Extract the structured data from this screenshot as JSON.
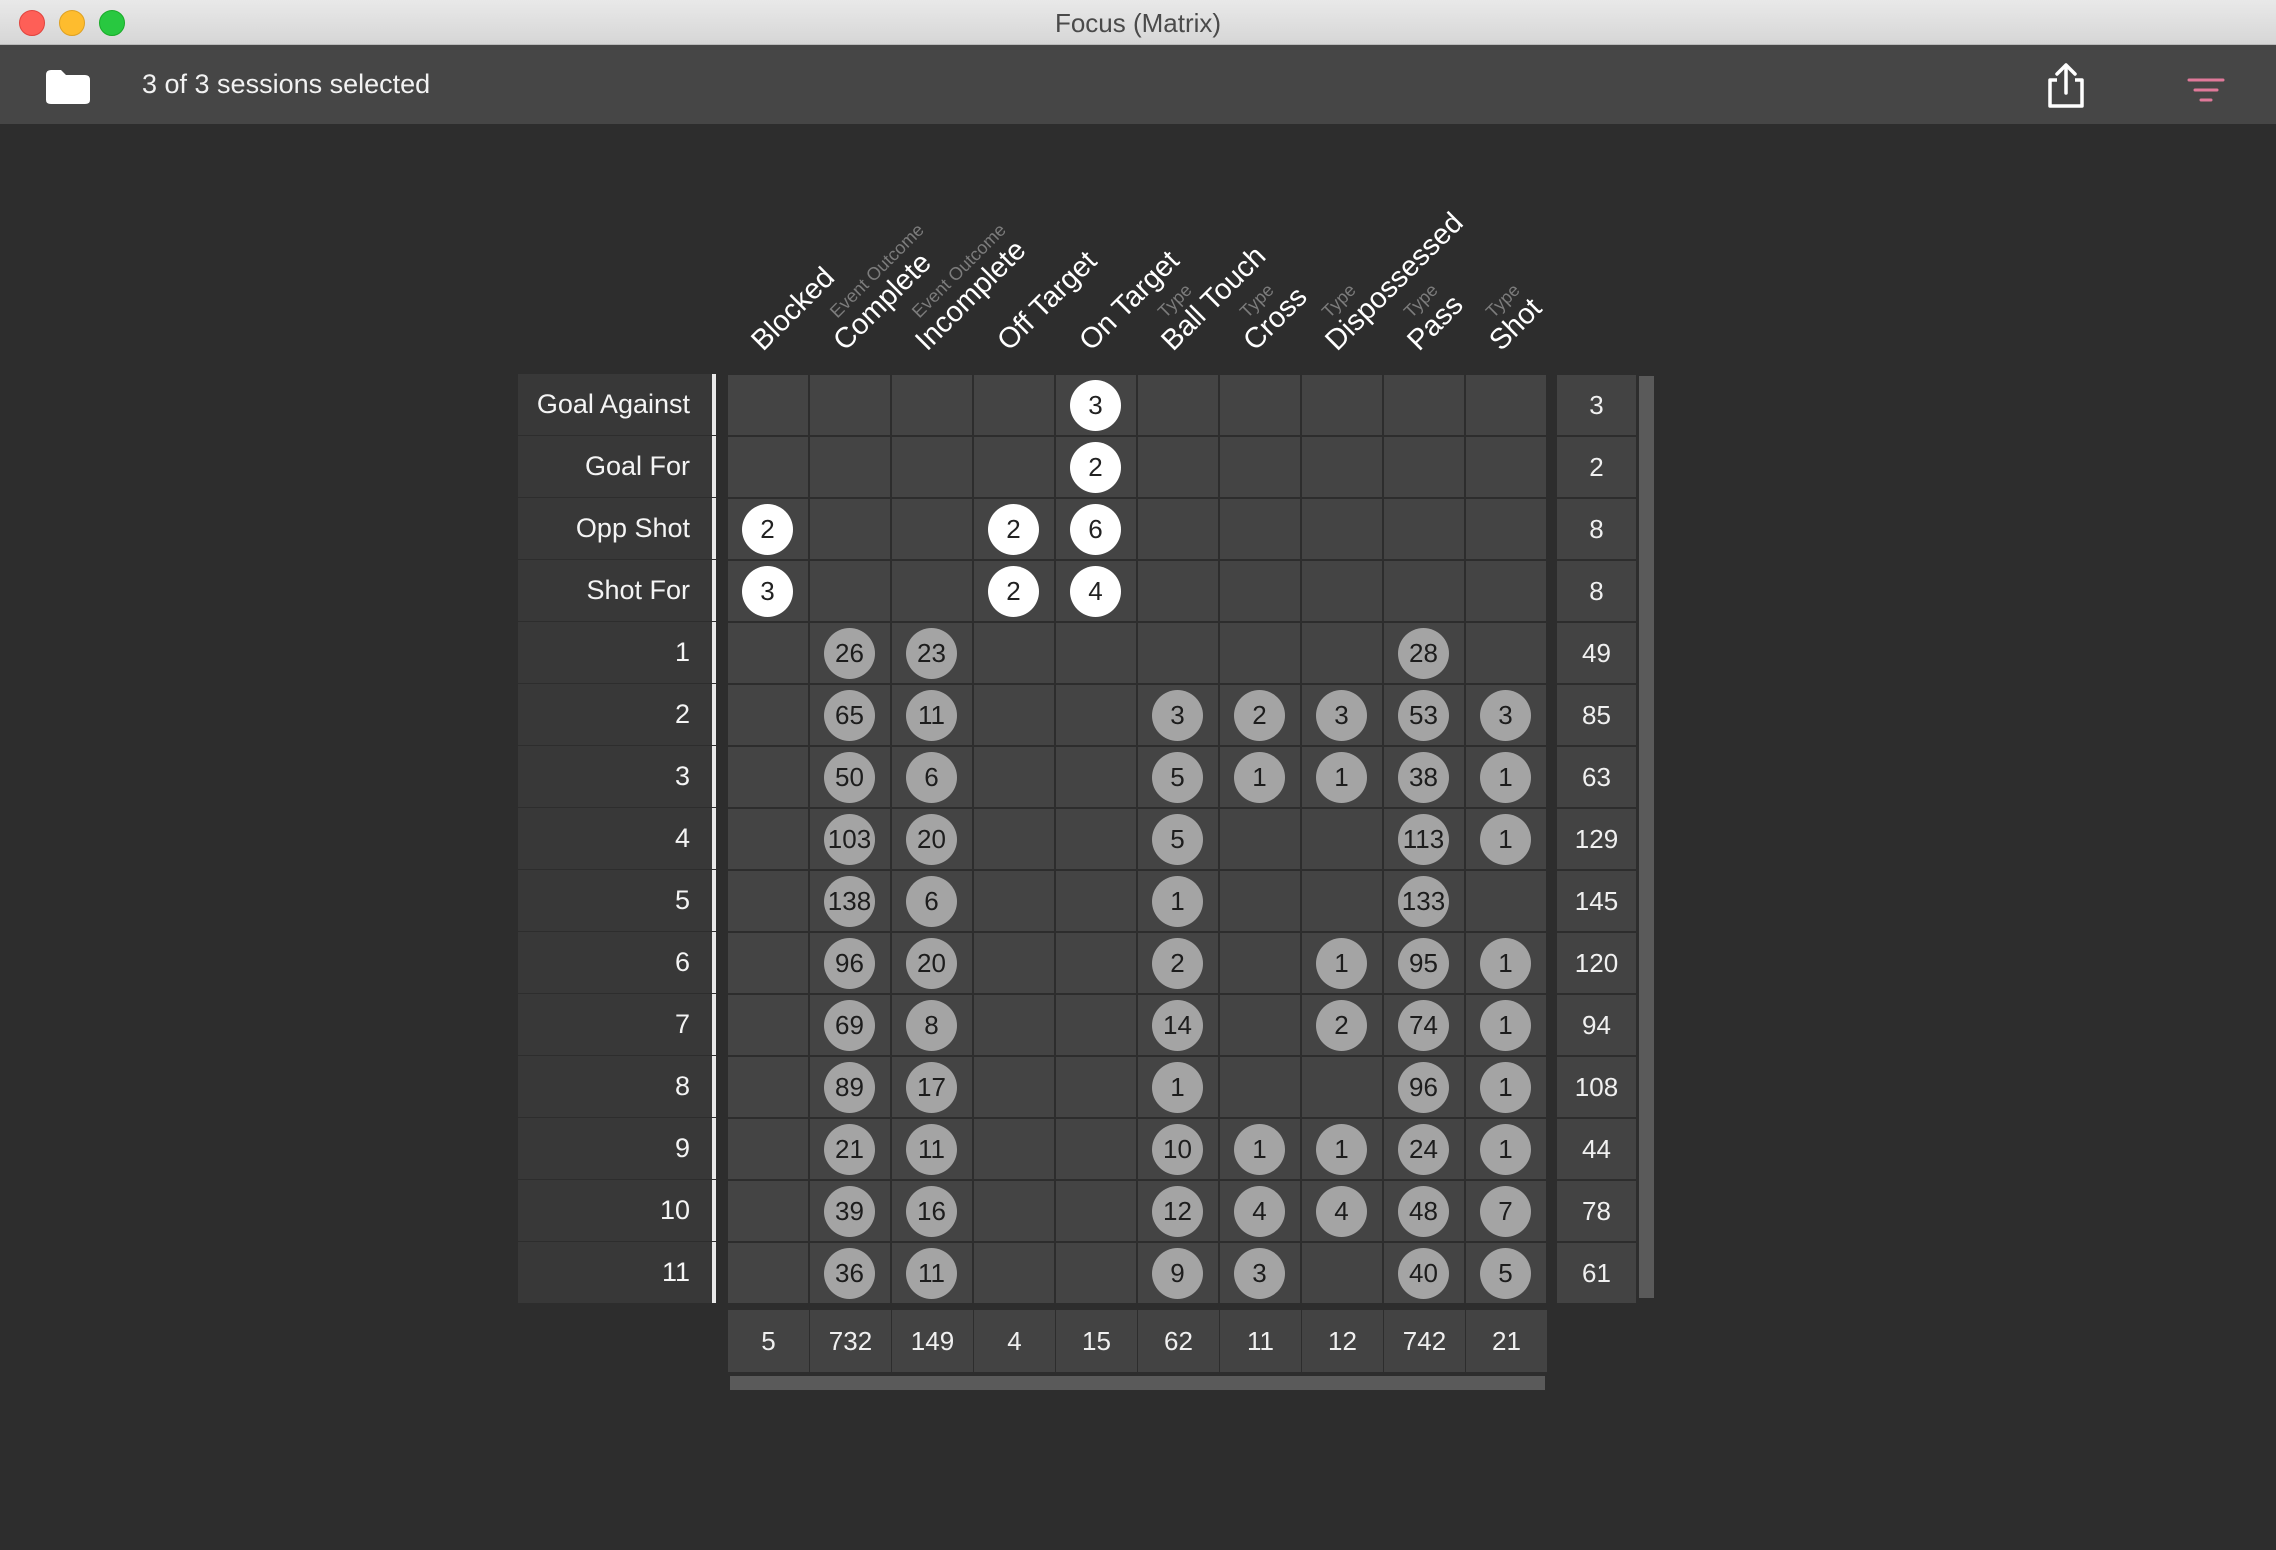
{
  "window": {
    "title": "Focus (Matrix)"
  },
  "toolbar": {
    "status": "3 of 3 sessions selected",
    "left_icon": "folder-icon",
    "share_icon": "share-icon",
    "filter_icon": "filter-icon",
    "filter_color": "#e0799a"
  },
  "matrix": {
    "columns": [
      {
        "category": "",
        "label": "Blocked"
      },
      {
        "category": "Event Outcome",
        "label": "Complete"
      },
      {
        "category": "Event Outcome",
        "label": "Incomplete"
      },
      {
        "category": "",
        "label": "Off Target"
      },
      {
        "category": "",
        "label": "On Target"
      },
      {
        "category": "Type",
        "label": "Ball Touch"
      },
      {
        "category": "Type",
        "label": "Cross"
      },
      {
        "category": "Type",
        "label": "Dispossessed"
      },
      {
        "category": "Type",
        "label": "Pass"
      },
      {
        "category": "Type",
        "label": "Shot"
      }
    ],
    "rows": [
      {
        "label": "Goal Against",
        "style": "white",
        "values": [
          null,
          null,
          null,
          null,
          3,
          null,
          null,
          null,
          null,
          null
        ],
        "total": "3"
      },
      {
        "label": "Goal For",
        "style": "white",
        "values": [
          null,
          null,
          null,
          null,
          2,
          null,
          null,
          null,
          null,
          null
        ],
        "total": "2"
      },
      {
        "label": "Opp Shot",
        "style": "white",
        "values": [
          2,
          null,
          null,
          2,
          6,
          null,
          null,
          null,
          null,
          null
        ],
        "total": "8"
      },
      {
        "label": "Shot For",
        "style": "white",
        "values": [
          3,
          null,
          null,
          2,
          4,
          null,
          null,
          null,
          null,
          null
        ],
        "total": "8"
      },
      {
        "label": "1",
        "style": "gray",
        "values": [
          null,
          26,
          23,
          null,
          null,
          null,
          null,
          null,
          28,
          null
        ],
        "total": "49"
      },
      {
        "label": "2",
        "style": "gray",
        "values": [
          null,
          65,
          11,
          null,
          null,
          3,
          2,
          3,
          53,
          3
        ],
        "total": "85"
      },
      {
        "label": "3",
        "style": "gray",
        "values": [
          null,
          50,
          6,
          null,
          null,
          5,
          1,
          1,
          38,
          1
        ],
        "total": "63"
      },
      {
        "label": "4",
        "style": "gray",
        "values": [
          null,
          103,
          20,
          null,
          null,
          5,
          null,
          null,
          113,
          1
        ],
        "total": "129"
      },
      {
        "label": "5",
        "style": "gray",
        "values": [
          null,
          138,
          6,
          null,
          null,
          1,
          null,
          null,
          133,
          null
        ],
        "total": "145"
      },
      {
        "label": "6",
        "style": "gray",
        "values": [
          null,
          96,
          20,
          null,
          null,
          2,
          null,
          1,
          95,
          1
        ],
        "total": "120"
      },
      {
        "label": "7",
        "style": "gray",
        "values": [
          null,
          69,
          8,
          null,
          null,
          14,
          null,
          2,
          74,
          1
        ],
        "total": "94"
      },
      {
        "label": "8",
        "style": "gray",
        "values": [
          null,
          89,
          17,
          null,
          null,
          1,
          null,
          null,
          96,
          1
        ],
        "total": "108"
      },
      {
        "label": "9",
        "style": "gray",
        "values": [
          null,
          21,
          11,
          null,
          null,
          10,
          1,
          1,
          24,
          1
        ],
        "total": "44"
      },
      {
        "label": "10",
        "style": "gray",
        "values": [
          null,
          39,
          16,
          null,
          null,
          12,
          4,
          4,
          48,
          7
        ],
        "total": "78"
      },
      {
        "label": "11",
        "style": "gray",
        "values": [
          null,
          36,
          11,
          null,
          null,
          9,
          3,
          null,
          40,
          5
        ],
        "total": "61"
      }
    ],
    "column_totals": [
      "5",
      "732",
      "149",
      "4",
      "15",
      "62",
      "11",
      "12",
      "742",
      "21"
    ]
  }
}
